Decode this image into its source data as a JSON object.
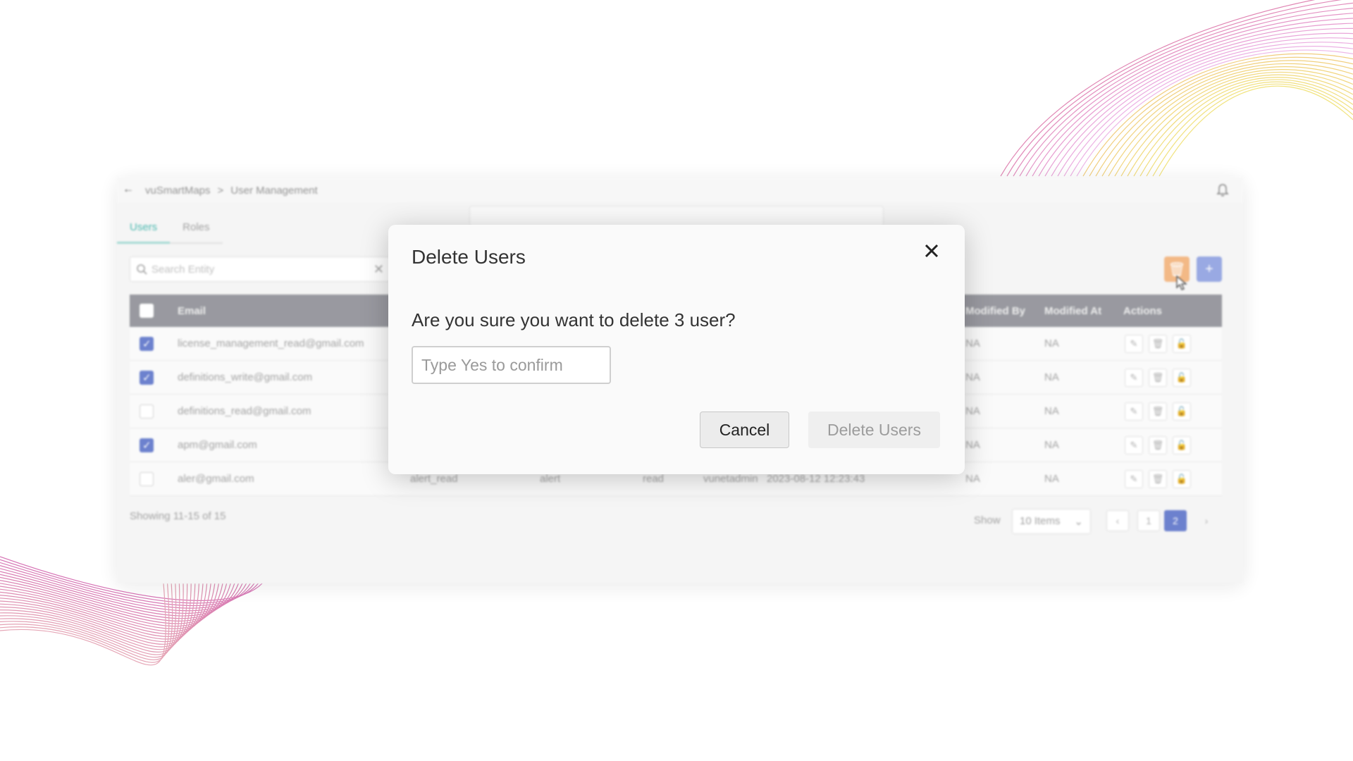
{
  "breadcrumb": {
    "root": "vuSmartMaps",
    "separator": ">",
    "current": "User Management"
  },
  "tabs": [
    {
      "label": "Users",
      "active": true
    },
    {
      "label": "Roles",
      "active": false
    }
  ],
  "search": {
    "placeholder": "Search Entity"
  },
  "table": {
    "columns": [
      "Email",
      "Modified By",
      "Modified At",
      "Actions"
    ],
    "rows": [
      {
        "checked": true,
        "email": "license_management_read@gmail.com",
        "modified_by": "NA",
        "modified_at": "NA"
      },
      {
        "checked": true,
        "email": "definitions_write@gmail.com",
        "modified_by": "NA",
        "modified_at": "NA"
      },
      {
        "checked": false,
        "email": "definitions_read@gmail.com",
        "modified_by": "NA",
        "modified_at": "NA"
      },
      {
        "checked": true,
        "email": "apm@gmail.com",
        "modified_by": "NA",
        "modified_at": "NA"
      },
      {
        "checked": false,
        "email": "aler@gmail.com",
        "role": "alert_read",
        "module": "alert",
        "permission": "read",
        "created_by": "vunetadmin",
        "created_at": "2023-08-12 12:23:43",
        "modified_by": "NA",
        "modified_at": "NA"
      }
    ]
  },
  "footer": {
    "showing": "Showing 11-15 of 15",
    "show_label": "Show",
    "items_per_page": "10 Items",
    "pages": [
      "1",
      "2"
    ],
    "current_page": "2"
  },
  "modal": {
    "title": "Delete Users",
    "question": "Are you sure you want to delete 3 user?",
    "input_placeholder": "Type Yes to confirm",
    "cancel_label": "Cancel",
    "delete_label": "Delete Users"
  },
  "colors": {
    "accent_teal": "#3bb3a9",
    "primary_blue": "#5d74c9",
    "delete_orange": "#f2b27a",
    "header_gray": "#8e8f96"
  }
}
